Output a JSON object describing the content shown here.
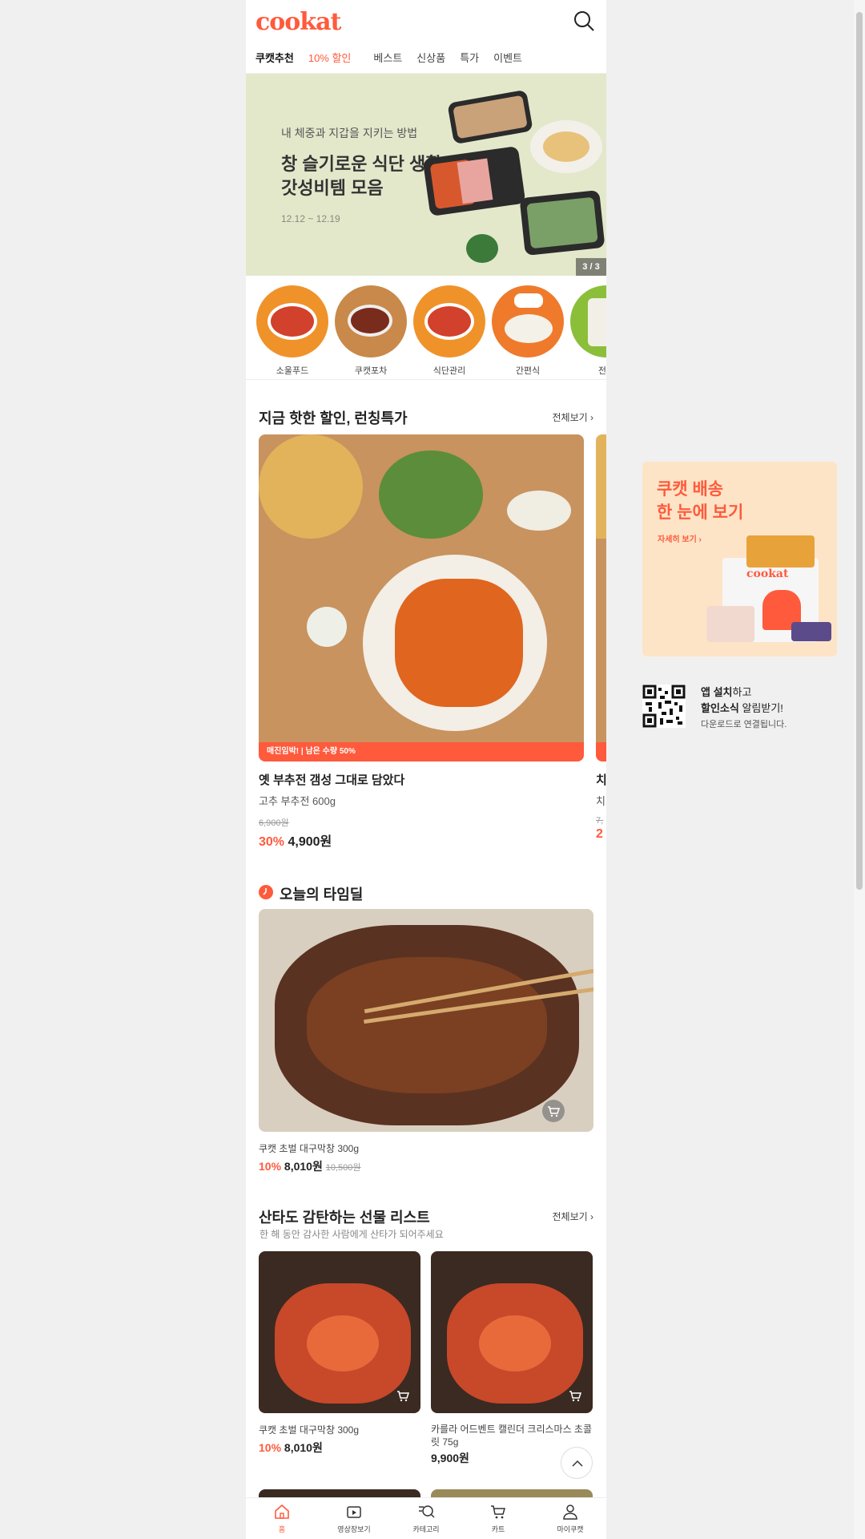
{
  "header": {
    "logo": "cookat"
  },
  "tabs": [
    {
      "label": "쿠캣추천"
    },
    {
      "label": "10% 할인"
    },
    {
      "label": "베스트"
    },
    {
      "label": "신상품"
    },
    {
      "label": "특가"
    },
    {
      "label": "이벤트"
    }
  ],
  "banner": {
    "subtitle": "내 체중과 지갑을 지키는 방법",
    "title_line1": "창 슬기로운 식단 생활",
    "title_line2": "갓성비템 모음",
    "date": "12.12 ~ 12.19",
    "counter": "3 / 3"
  },
  "categories": [
    {
      "label": "소울푸드"
    },
    {
      "label": "쿠캣포차"
    },
    {
      "label": "식단관리"
    },
    {
      "label": "간편식"
    },
    {
      "label": "전통"
    }
  ],
  "hot_deals": {
    "title": "지금 핫한 할인, 런칭특가",
    "see_all": "전체보기",
    "items": [
      {
        "badge": "매진임박! | 남은 수량 50%",
        "name": "옛 부추전 갬성 그대로 담았다",
        "subtitle": "고추 부추전 600g",
        "original_price": "6,900원",
        "discount": "30%",
        "price": "4,900원"
      },
      {
        "name": "치",
        "subtitle": "치",
        "original_price": "7,",
        "discount": "2"
      }
    ]
  },
  "time_deal": {
    "title": "오늘의 타임딜",
    "name": "쿠캣 초벌 대구막창 300g",
    "discount": "10%",
    "price": "8,010원",
    "original_price": "10,500원"
  },
  "gift": {
    "title": "산타도 감탄하는 선물 리스트",
    "subtitle": "한 해 동안 감사한 사람에게 산타가 되어주세요",
    "see_all": "전체보기",
    "items": [
      {
        "name": "쿠캣 초벌 대구막창 300g",
        "discount": "10%",
        "price": "8,010원"
      },
      {
        "name": "카를라 어드벤트 캘린더 크리스마스 초콜릿 75g",
        "price": "9,900원"
      }
    ]
  },
  "bottom_nav": [
    {
      "label": "홈"
    },
    {
      "label": "영상장보기"
    },
    {
      "label": "카테고리"
    },
    {
      "label": "카트"
    },
    {
      "label": "마이쿠캣"
    }
  ],
  "side": {
    "promo_line1": "쿠캣 배송",
    "promo_line2": "한 눈에 보기",
    "promo_link": "자세히 보기",
    "promo_box_logo": "cookat",
    "app_install_bold": "앱 설치",
    "app_install_rest": "하고",
    "app_alert_bold": "할인소식",
    "app_alert_rest": " 알림받기!",
    "app_desc": "다운로드로 연결됩니다."
  },
  "colors": {
    "accent": "#ff5a3c",
    "banner_bg": "#e3e8cb",
    "promo_bg": "#fde4c6"
  }
}
